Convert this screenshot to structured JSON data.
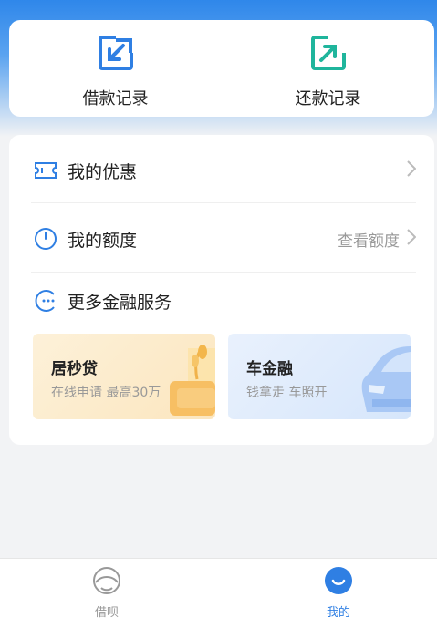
{
  "records": {
    "borrow_label": "借款记录",
    "repay_label": "还款记录"
  },
  "menu": {
    "discounts_label": "我的优惠",
    "quota_label": "我的额度",
    "quota_action": "查看额度",
    "services_label": "更多金融服务"
  },
  "promos": [
    {
      "title": "居秒贷",
      "subtitle": "在线申请  最高30万"
    },
    {
      "title": "车金融",
      "subtitle": "钱拿走  车照开"
    }
  ],
  "tabbar": {
    "tab1_label": "借呗",
    "tab2_label": "我的"
  },
  "colors": {
    "accent_blue": "#2f7fe3",
    "accent_teal": "#1fb59c"
  }
}
